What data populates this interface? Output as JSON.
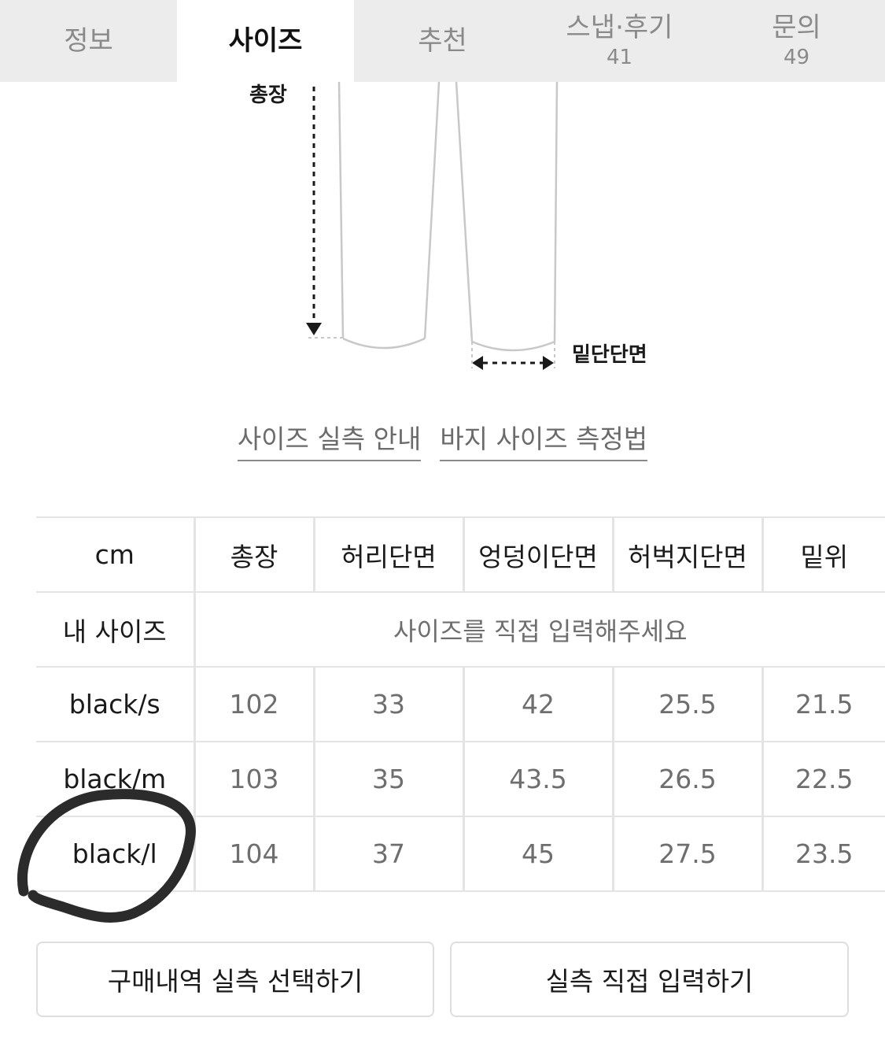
{
  "tabs": [
    {
      "label": "정보",
      "count": ""
    },
    {
      "label": "사이즈",
      "count": ""
    },
    {
      "label": "추천",
      "count": ""
    },
    {
      "label": "스냅·후기",
      "count": "41"
    },
    {
      "label": "문의",
      "count": "49"
    }
  ],
  "active_tab": "사이즈",
  "diagram": {
    "total_length_label": "총장",
    "hem_label": "밑단단면"
  },
  "links": {
    "size_guide": "사이즈 실측 안내",
    "pants_measure": "바지 사이즈 측정법"
  },
  "table": {
    "headers": [
      "cm",
      "총장",
      "허리단면",
      "엉덩이단면",
      "허벅지단면",
      "밑위"
    ],
    "my_size_label": "내 사이즈",
    "my_size_placeholder": "사이즈를 직접 입력해주세요",
    "rows": [
      {
        "name": "black/s",
        "values": [
          "102",
          "33",
          "42",
          "25.5",
          "21.5"
        ]
      },
      {
        "name": "black/m",
        "values": [
          "103",
          "35",
          "43.5",
          "26.5",
          "22.5"
        ]
      },
      {
        "name": "black/l",
        "values": [
          "104",
          "37",
          "45",
          "27.5",
          "23.5"
        ]
      }
    ]
  },
  "buttons": {
    "purchase_history": "구매내역 실측 선택하기",
    "manual_input": "실측 직접 입력하기"
  },
  "colors": {
    "tab_bg": "#ececec",
    "border": "#e4e4e4",
    "muted_text": "#6e6e6e",
    "annotation": "#2b2b2b"
  }
}
